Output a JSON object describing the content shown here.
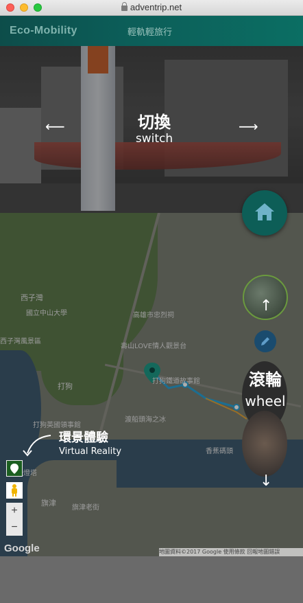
{
  "browser": {
    "url": "adventrip.net"
  },
  "header": {
    "brand": "Eco-Mobility",
    "nav_link": "輕軌輕旅行"
  },
  "photo_overlay": {
    "switch_cn": "切換",
    "switch_en": "switch",
    "left_arrow": "⟵",
    "right_arrow": "⟶"
  },
  "wheel_overlay": {
    "wheel_cn": "滾輪",
    "wheel_en": "wheel",
    "up_arrow": "↑",
    "down_arrow": "↓"
  },
  "vr_overlay": {
    "vr_cn": "環景體驗",
    "vr_en": "Virtual Reality"
  },
  "map": {
    "labels": [
      "西子灣",
      "國立中山大學",
      "高雄市忠烈祠",
      "壽山LOVE情人觀景台",
      "西子灣風景區",
      "打狗",
      "打狗鐵道故事館",
      "渡船頭海之冰",
      "打狗英國領事館",
      "旗津",
      "香蕉碼頭",
      "旗津老街",
      "旗後燈塔"
    ],
    "zoom_in": "+",
    "zoom_out": "−",
    "google_logo": "Google",
    "attribution": "地圖資料©2017 Google  使用條款  回報地圖錯誤"
  },
  "colors": {
    "header_start": "#0d4d4a",
    "header_end": "#0b6e63",
    "fab": "#0d5e57",
    "route": "#2aa3d6"
  }
}
